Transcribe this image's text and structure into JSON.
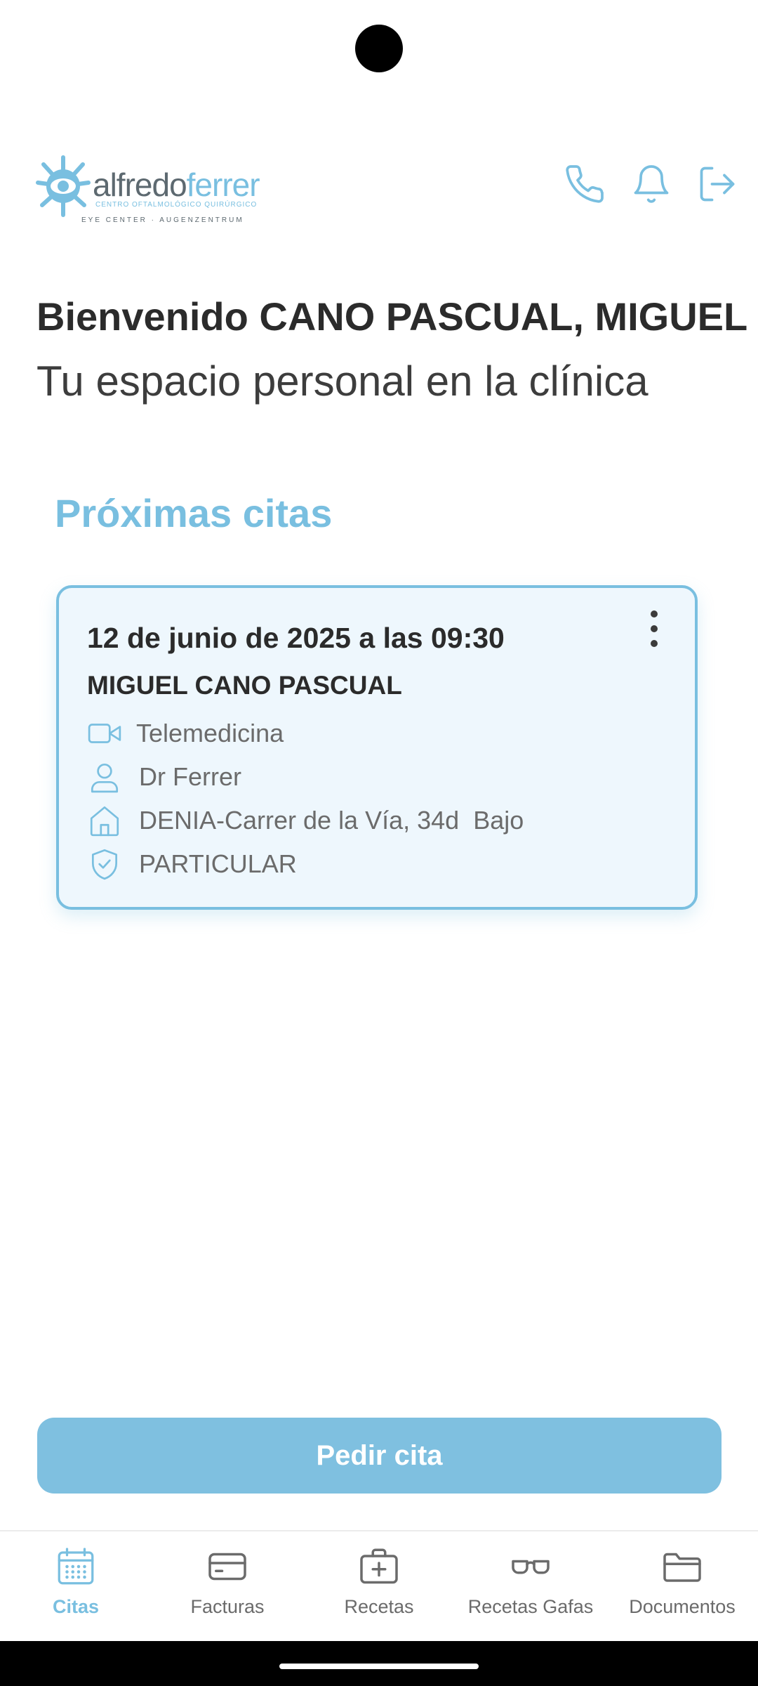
{
  "header": {
    "logo": {
      "word_a": "alfredo",
      "word_b": "ferrer",
      "tagline": "CENTRO OFTALMOLÓGICO QUIRÚRGICO",
      "subline": "EYE CENTER · AUGENZENTRUM"
    },
    "icons": [
      "phone-icon",
      "bell-icon",
      "logout-icon"
    ]
  },
  "welcome": {
    "greeting": "Bienvenido CANO PASCUAL, MIGUEL",
    "subtitle": "Tu espacio personal en la clínica"
  },
  "appointments": {
    "section_title": "Próximas citas",
    "items": [
      {
        "datetime": "12 de junio de 2025 a las 09:30",
        "patient": "MIGUEL CANO PASCUAL",
        "type": "Telemedicina",
        "doctor": "Dr Ferrer",
        "location": "DENIA-Carrer de la Vía, 34d  Bajo",
        "insurance": "PARTICULAR"
      }
    ]
  },
  "cta": {
    "label": "Pedir cita"
  },
  "nav": {
    "items": [
      {
        "label": "Citas",
        "icon": "calendar-icon",
        "active": true
      },
      {
        "label": "Facturas",
        "icon": "credit-card-icon",
        "active": false
      },
      {
        "label": "Recetas",
        "icon": "medical-kit-icon",
        "active": false
      },
      {
        "label": "Recetas Gafas",
        "icon": "glasses-icon",
        "active": false
      },
      {
        "label": "Documentos",
        "icon": "folder-icon",
        "active": false
      }
    ]
  },
  "colors": {
    "accent": "#79bfe0",
    "card_bg": "#eef7fd",
    "text_dark": "#2b2b2b",
    "text_muted": "#6b6b6b"
  }
}
